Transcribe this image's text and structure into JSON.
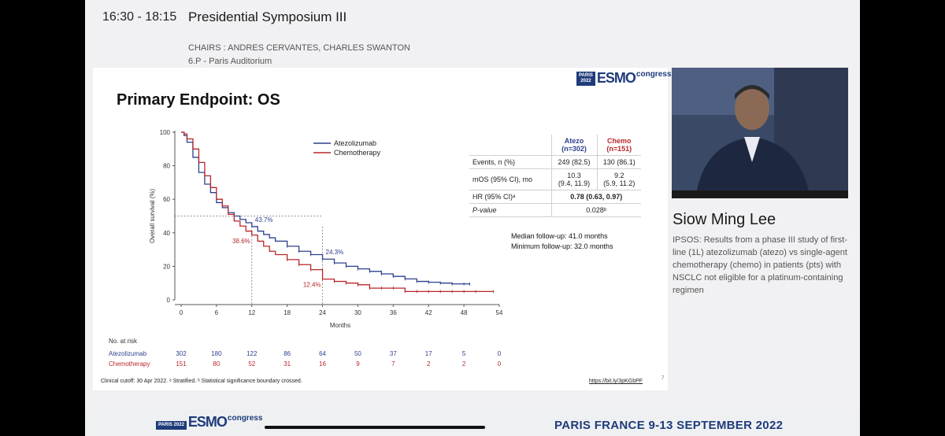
{
  "header": {
    "time": "16:30 - 18:15",
    "session_title": "Presidential Symposium III",
    "chairs": "CHAIRS : ANDRES CERVANTES, CHARLES SWANTON",
    "room": "6.P - Paris Auditorium"
  },
  "slide": {
    "logo_year": "PARIS 2022",
    "logo_word": "ESMO",
    "logo_congress": "congress",
    "title": "Primary Endpoint: OS",
    "table": {
      "col_atezo": "Atezo",
      "col_atezo_n": "(n=302)",
      "col_chemo": "Chemo",
      "col_chemo_n": "(n=151)",
      "rows": [
        {
          "label": "Events, n (%)",
          "atezo": "249 (82.5)",
          "chemo": "130 (86.1)"
        },
        {
          "label": "mOS (95% CI), mo",
          "atezo": "10.3",
          "atezo2": "(9.4, 11.9)",
          "chemo": "9.2",
          "chemo2": "(5.9, 11.2)"
        },
        {
          "label": "HR (95% CI)ᵃ",
          "value": "0.78 (0.63, 0.97)"
        },
        {
          "label": "P-value",
          "value": "0.028ᵇ"
        }
      ]
    },
    "followup_median": "Median follow-up: 41.0 months",
    "followup_min": "Minimum follow-up: 32.0 months",
    "footnote": "Clinical cutoff: 30 Apr 2022. ᵃ Stratified. ᵇ Statistical significance boundary crossed.",
    "link": "https://bit.ly/3pKGbPF",
    "page": "7"
  },
  "colors": {
    "atezo": "#2d3f8f",
    "chemo": "#b8262b",
    "brand": "#1f3b7a"
  },
  "chart_data": {
    "type": "line",
    "xlabel": "Months",
    "ylabel": "Overall survival (%)",
    "xlim": [
      0,
      54
    ],
    "ylim": [
      0,
      100
    ],
    "xticks": [
      0,
      6,
      12,
      18,
      24,
      30,
      36,
      42,
      48,
      54
    ],
    "yticks": [
      0,
      20,
      40,
      60,
      80,
      100
    ],
    "legend_position": "top-center",
    "series": [
      {
        "name": "Atezolizumab",
        "color": "#2d3f8f",
        "x": [
          0,
          0.5,
          1,
          2,
          3,
          4,
          5,
          6,
          7,
          8,
          9,
          10,
          11,
          12,
          13,
          14,
          15,
          16,
          18,
          20,
          22,
          24,
          26,
          28,
          30,
          32,
          34,
          36,
          38,
          40,
          42,
          44,
          46,
          48,
          49
        ],
        "y": [
          100,
          98,
          94,
          85,
          76,
          69,
          64,
          58,
          55,
          52,
          50,
          48,
          46,
          43.7,
          41,
          39,
          37,
          35,
          32,
          29,
          27,
          24.3,
          22,
          20,
          18.5,
          17,
          15.5,
          14,
          12.5,
          11,
          10.5,
          10,
          9.5,
          9.5,
          9.5
        ]
      },
      {
        "name": "Chemotherapy",
        "color": "#b8262b",
        "x": [
          0,
          0.5,
          1,
          2,
          3,
          4,
          5,
          6,
          7,
          8,
          9,
          10,
          11,
          12,
          13,
          14,
          15,
          16,
          18,
          20,
          22,
          24,
          26,
          28,
          30,
          32,
          34,
          36,
          38,
          40,
          42,
          44,
          46,
          48,
          50,
          53
        ],
        "y": [
          100,
          99,
          96,
          90,
          82,
          74,
          67,
          60,
          56,
          51,
          47,
          44,
          41,
          38.6,
          35,
          32,
          29,
          27,
          24,
          21,
          18,
          12.4,
          11,
          10,
          9,
          7,
          7,
          7,
          5,
          5,
          5,
          5,
          5,
          5,
          5,
          5
        ]
      }
    ],
    "annotations": [
      {
        "text": "43.7%",
        "x": 12,
        "y": 43.7,
        "series": "Atezolizumab"
      },
      {
        "text": "38.6%",
        "x": 12,
        "y": 38.6,
        "series": "Chemotherapy"
      },
      {
        "text": "24.3%",
        "x": 24,
        "y": 24.3,
        "series": "Atezolizumab"
      },
      {
        "text": "12.4%",
        "x": 24,
        "y": 12.4,
        "series": "Chemotherapy"
      }
    ],
    "reference_line_y": 50,
    "risk_table": {
      "title": "No. at risk",
      "times": [
        0,
        6,
        12,
        18,
        24,
        30,
        36,
        42,
        48,
        54
      ],
      "rows": [
        {
          "name": "Atezolizumab",
          "values": [
            302,
            180,
            122,
            86,
            64,
            50,
            37,
            17,
            5,
            0
          ]
        },
        {
          "name": "Chemotherapy",
          "values": [
            151,
            80,
            52,
            31,
            16,
            9,
            7,
            2,
            2,
            0
          ]
        }
      ]
    }
  },
  "speaker": {
    "name": "Siow Ming Lee",
    "description": "IPSOS: Results from a phase III study of first-line (1L) atezolizumab (atezo) vs single-agent chemotherapy (chemo) in patients (pts) with NSCLC not eligible for a platinum-containing regimen"
  },
  "footer": {
    "logo_year": "PARIS 2022",
    "logo_word": "ESMO",
    "logo_congress": "congress",
    "location_date": "PARIS FRANCE  9-13 SEPTEMBER 2022"
  }
}
